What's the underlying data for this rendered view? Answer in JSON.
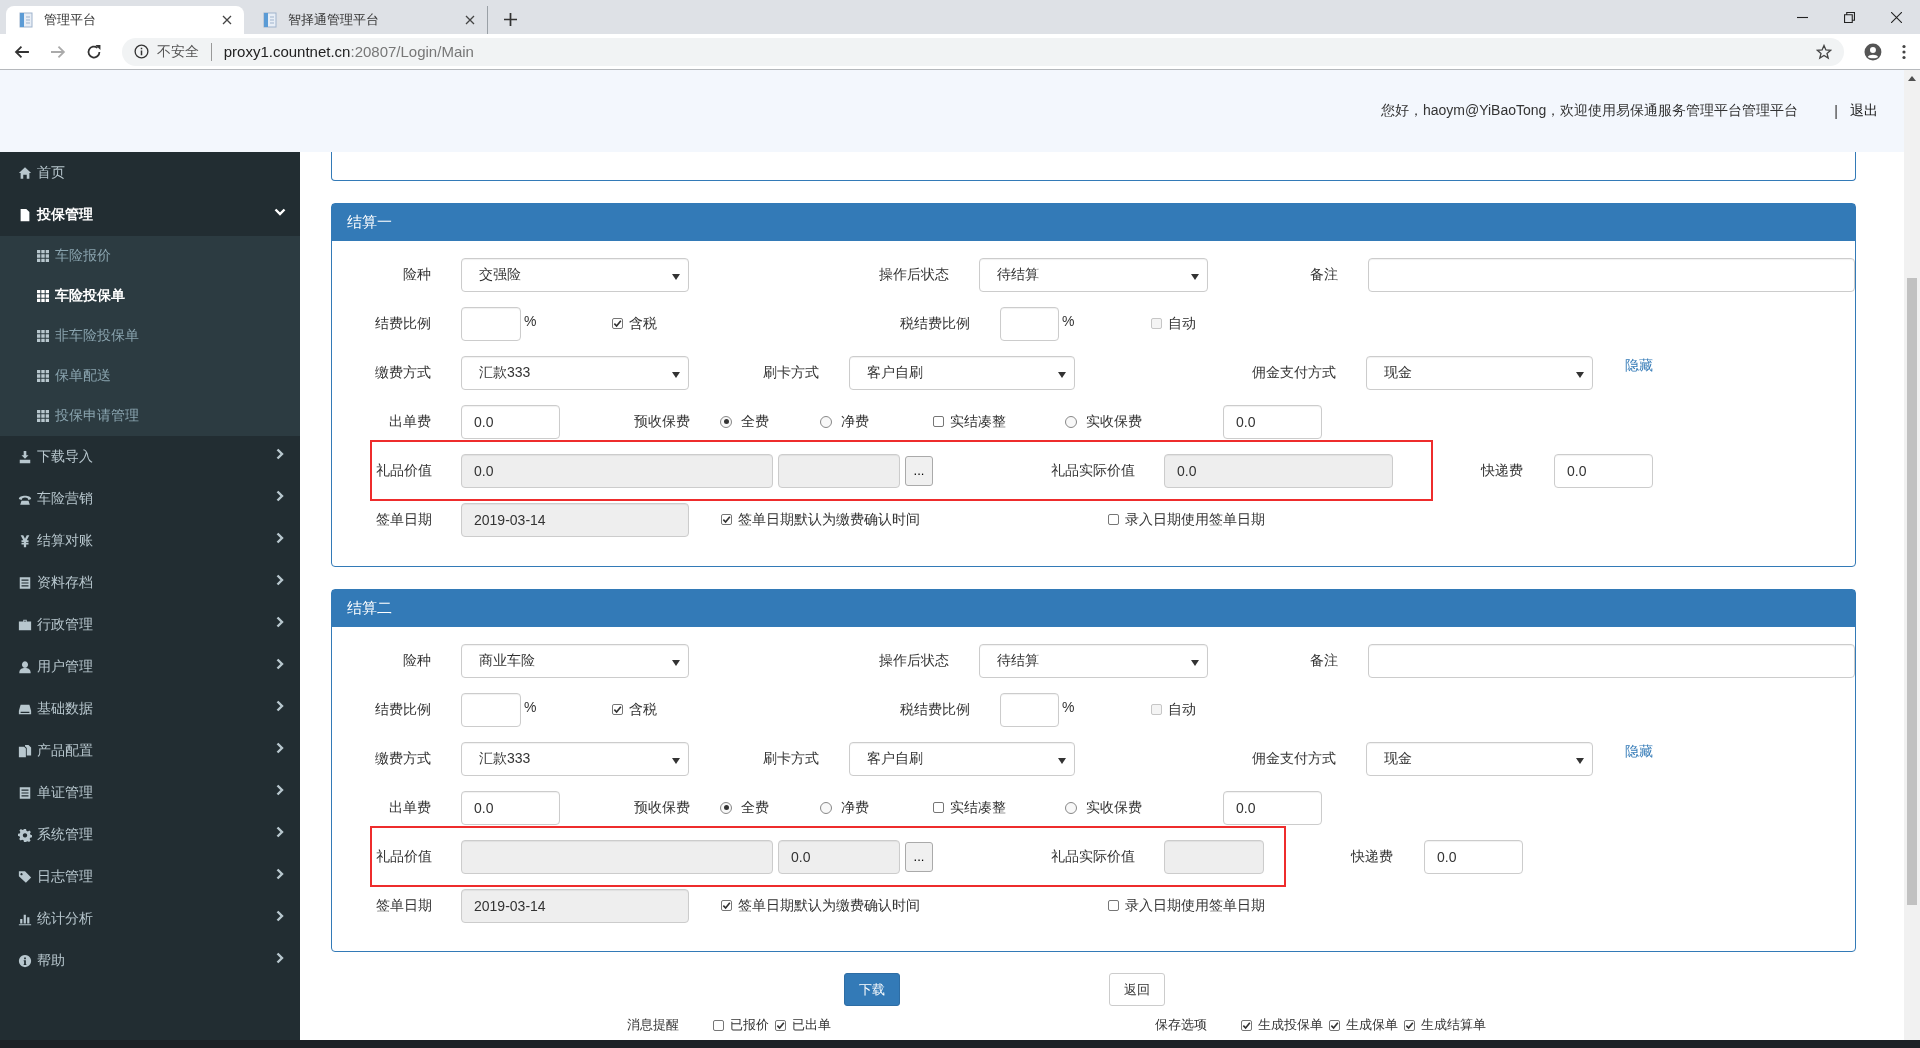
{
  "browser": {
    "tabs": [
      {
        "title": "管理平台",
        "selected": true
      },
      {
        "title": "智择通管理平台",
        "selected": false
      }
    ],
    "security": "不安全",
    "url_host": "proxy1.countnet.cn",
    "url_path": ":20807/Login/Main"
  },
  "header": {
    "greeting": "您好，haoym@YiBaoTong，欢迎使用易保通服务管理平台管理平台",
    "separator": "|",
    "logout": "退出"
  },
  "sidebar": {
    "items": [
      {
        "label": "首页",
        "kind": "link"
      },
      {
        "label": "投保管理",
        "kind": "menu",
        "expanded": true,
        "children": [
          {
            "label": "车险报价",
            "selected": false
          },
          {
            "label": "车险投保单",
            "selected": true
          },
          {
            "label": "非车险投保单",
            "selected": false
          },
          {
            "label": "保单配送",
            "selected": false
          },
          {
            "label": "投保申请管理",
            "selected": false
          }
        ]
      },
      {
        "label": "下载导入",
        "kind": "menu",
        "expanded": false
      },
      {
        "label": "车险营销",
        "kind": "menu",
        "expanded": false
      },
      {
        "label": "结算对账",
        "kind": "menu",
        "expanded": false
      },
      {
        "label": "资料存档",
        "kind": "menu",
        "expanded": false
      },
      {
        "label": "行政管理",
        "kind": "menu",
        "expanded": false
      },
      {
        "label": "用户管理",
        "kind": "menu",
        "expanded": false
      },
      {
        "label": "基础数据",
        "kind": "menu",
        "expanded": false
      },
      {
        "label": "产品配置",
        "kind": "menu",
        "expanded": false
      },
      {
        "label": "单证管理",
        "kind": "menu",
        "expanded": false
      },
      {
        "label": "系统管理",
        "kind": "menu",
        "expanded": false
      },
      {
        "label": "日志管理",
        "kind": "menu",
        "expanded": false
      },
      {
        "label": "统计分析",
        "kind": "menu",
        "expanded": false
      },
      {
        "label": "帮助",
        "kind": "menu",
        "expanded": false
      }
    ]
  },
  "panels": [
    {
      "title": "结算一",
      "insurance_type": {
        "label": "险种",
        "value": "交强险"
      },
      "status_after": {
        "label": "操作后状态",
        "value": "待结算"
      },
      "remarks": {
        "label": "备注"
      },
      "fee_ratio": {
        "label": "结费比例",
        "unit": "%"
      },
      "tax_included": {
        "label": "含税",
        "checked": true,
        "disabled": false
      },
      "tax_fee_ratio": {
        "label": "税结费比例",
        "unit": "%"
      },
      "auto": {
        "label": "自动",
        "checked": false,
        "disabled": true
      },
      "payment_method": {
        "label": "缴费方式",
        "value": "汇款333"
      },
      "card_method": {
        "label": "刷卡方式",
        "value": "客户自刷"
      },
      "commission_method": {
        "label": "佣金支付方式",
        "value": "现金"
      },
      "hide_link": "隐藏",
      "issuing_fee": {
        "label": "出单费",
        "value": "0.0"
      },
      "premium": {
        "label": "预收保费",
        "options": [
          {
            "kind": "radio",
            "label": "全费",
            "selected": true
          },
          {
            "kind": "radio",
            "label": "净费",
            "selected": false
          },
          {
            "kind": "checkbox",
            "label": "实结凑整",
            "checked": false
          },
          {
            "kind": "radio",
            "label": "实收保费",
            "selected": false
          }
        ],
        "value": "0.0"
      },
      "gift": {
        "label": "礼品价值",
        "highlighted": true,
        "fields": [
          {
            "value": "0.0",
            "disabled": true
          },
          {
            "disabled": true
          }
        ],
        "browse_button": "..."
      },
      "gift_actual": {
        "label": "礼品实际价值",
        "value": "0.0",
        "disabled": true
      },
      "express_fee": {
        "label": "快递费",
        "value": "0.0"
      },
      "sign_date": {
        "label": "签单日期",
        "value": "2019-03-14",
        "disabled": true
      },
      "sign_default": {
        "label": "签单日期默认为缴费确认时间",
        "checked": true,
        "disabled": false
      },
      "entry_use_sign": {
        "label": "录入日期使用签单日期",
        "checked": false,
        "disabled": false
      }
    },
    {
      "title": "结算二",
      "insurance_type": {
        "label": "险种",
        "value": "商业车险"
      },
      "status_after": {
        "label": "操作后状态",
        "value": "待结算"
      },
      "remarks": {
        "label": "备注"
      },
      "fee_ratio": {
        "label": "结费比例",
        "unit": "%"
      },
      "tax_included": {
        "label": "含税",
        "checked": true,
        "disabled": false
      },
      "tax_fee_ratio": {
        "label": "税结费比例",
        "unit": "%"
      },
      "auto": {
        "label": "自动",
        "checked": false,
        "disabled": true
      },
      "payment_method": {
        "label": "缴费方式",
        "value": "汇款333"
      },
      "card_method": {
        "label": "刷卡方式",
        "value": "客户自刷"
      },
      "commission_method": {
        "label": "佣金支付方式",
        "value": "现金"
      },
      "hide_link": "隐藏",
      "issuing_fee": {
        "label": "出单费",
        "value": "0.0"
      },
      "premium": {
        "label": "预收保费",
        "options": [
          {
            "kind": "radio",
            "label": "全费",
            "selected": true
          },
          {
            "kind": "radio",
            "label": "净费",
            "selected": false
          },
          {
            "kind": "checkbox",
            "label": "实结凑整",
            "checked": false
          },
          {
            "kind": "radio",
            "label": "实收保费",
            "selected": false
          }
        ],
        "value": "0.0"
      },
      "gift": {
        "label": "礼品价值",
        "highlighted": true,
        "fields": [
          {
            "disabled": true
          },
          {
            "value": "0.0",
            "disabled": true
          }
        ],
        "browse_button": "..."
      },
      "gift_actual": {
        "label": "礼品实际价值",
        "disabled": true
      },
      "express_fee": {
        "label": "快递费",
        "value": "0.0"
      },
      "sign_date": {
        "label": "签单日期",
        "value": "2019-03-14",
        "disabled": true
      },
      "sign_default": {
        "label": "签单日期默认为缴费确认时间",
        "checked": true,
        "disabled": false
      },
      "entry_use_sign": {
        "label": "录入日期使用签单日期",
        "checked": false,
        "disabled": false
      }
    }
  ],
  "actions": [
    {
      "label": "下载",
      "kind": "primary"
    },
    {
      "label": "返回",
      "kind": "default"
    }
  ],
  "footer": {
    "groups": [
      {
        "label": "消息提醒",
        "options": [
          {
            "label": "已报价",
            "checked": false
          },
          {
            "label": "已出单",
            "checked": true
          }
        ]
      },
      {
        "label": "保存选项",
        "options": [
          {
            "label": "生成投保单",
            "checked": true
          },
          {
            "label": "生成保单",
            "checked": true
          },
          {
            "label": "生成结算单",
            "checked": true
          }
        ]
      }
    ]
  }
}
